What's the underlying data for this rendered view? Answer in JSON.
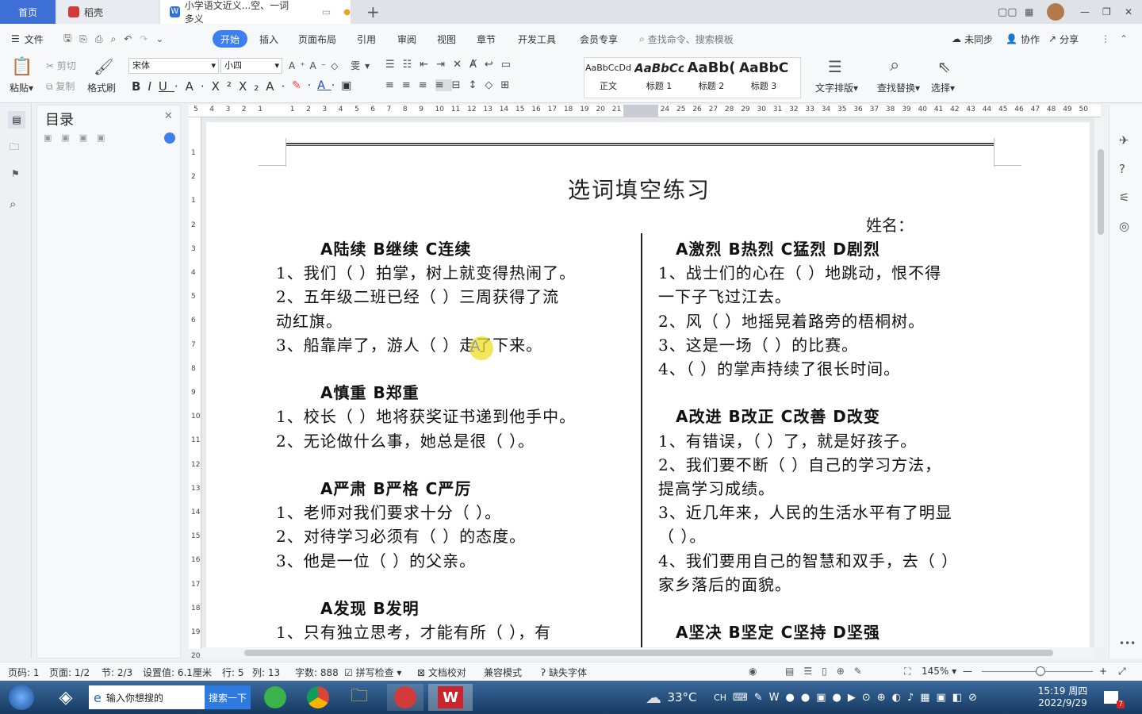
{
  "tabs": {
    "home": "首页",
    "daoke": "稻壳",
    "doc": "小学语文近义...空、一词多义"
  },
  "menu": {
    "file": "文件",
    "start": "开始",
    "insert": "插入",
    "layout": "页面布局",
    "ref": "引用",
    "review": "审阅",
    "view": "视图",
    "chapter": "章节",
    "dev": "开发工具",
    "member": "会员专享",
    "search": "查找命令、搜索模板",
    "sync": "未同步",
    "collab": "协作",
    "share": "分享"
  },
  "ribbon": {
    "paste": "粘贴",
    "cut": "剪切",
    "copy": "复制",
    "format_painter": "格式刷",
    "font": "宋体",
    "size": "小四",
    "styles": [
      {
        "preview": "AaBbCcDd",
        "name": "正文"
      },
      {
        "preview": "AaBbCc",
        "name": "标题 1"
      },
      {
        "preview": "AaBb(",
        "name": "标题 2"
      },
      {
        "preview": "AaBbC",
        "name": "标题 3"
      }
    ],
    "text_layout": "文字排版",
    "find_replace": "查找替换",
    "select": "选择"
  },
  "nav": {
    "title": "目录"
  },
  "ruler": {
    "marks": [
      "5",
      "4",
      "3",
      "2",
      "1",
      "",
      "1",
      "2",
      "3",
      "4",
      "5",
      "6",
      "7",
      "8",
      "9",
      "10",
      "11",
      "12",
      "13",
      "14",
      "15",
      "16",
      "17",
      "18",
      "19",
      "20",
      "21",
      "",
      "",
      "24",
      "25",
      "26",
      "27",
      "28",
      "29",
      "30",
      "31",
      "32",
      "33",
      "34",
      "35",
      "36",
      "37",
      "38",
      "39",
      "40",
      "41",
      "42",
      "43",
      "44",
      "45",
      "46",
      "47",
      "48",
      "49",
      "50"
    ],
    "vmarks": [
      "1",
      "2",
      "1",
      "2",
      "3",
      "4",
      "5",
      "6",
      "7",
      "8",
      "9",
      "10",
      "11",
      "12",
      "13",
      "14",
      "15",
      "16",
      "17",
      "18",
      "19",
      "20"
    ]
  },
  "doc": {
    "title": "选词填空练习",
    "name_label": "姓名：",
    "cursor_text": "A",
    "left": [
      {
        "h": "A陆续  B继续  C连续"
      },
      {
        "t": "1、我们（      ）拍掌，树上就变得热闹了。"
      },
      {
        "t": "2、五年级二班已经（      ）三周获得了流"
      },
      {
        "t": "动红旗。"
      },
      {
        "t": "3、船靠岸了，游人（      ）走了下来。"
      },
      {
        "h": "A慎重   B郑重"
      },
      {
        "t": "1、校长（      ）地将获奖证书递到他手中。"
      },
      {
        "t": "2、无论做什么事，她总是很（      ）。"
      },
      {
        "h": "A严肃   B严格   C严厉"
      },
      {
        "t": "1、老师对我们要求十分（      ）。"
      },
      {
        "t": "2、对待学习必须有（      ）的态度。"
      },
      {
        "t": "3、他是一位（     ）的父亲。"
      },
      {
        "h": "A发现   B发明"
      },
      {
        "t": "1、只有独立思考，才能有所（      ），有"
      }
    ],
    "right": [
      {
        "h": "A激烈  B热烈  C猛烈  D剧烈"
      },
      {
        "t": "1、战士们的心在（     ）地跳动，恨不得"
      },
      {
        "t": "一下子飞过江去。"
      },
      {
        "t": "2、风（     ）地摇晃着路旁的梧桐树。"
      },
      {
        "t": "3、这是一场（      ）的比赛。"
      },
      {
        "t": "4、（     ）的掌声持续了很长时间。"
      },
      {
        "h": "A改进   B改正   C改善  D改变"
      },
      {
        "t": "1、有错误，（     ）了，就是好孩子。"
      },
      {
        "t": "2、我们要不断（     ）自己的学习方法，"
      },
      {
        "t": "提高学习成绩。"
      },
      {
        "t": "3、近几年来，人民的生活水平有了明显"
      },
      {
        "t": "（     ）。"
      },
      {
        "t": "4、我们要用自己的智慧和双手，去（     ）"
      },
      {
        "t": "家乡落后的面貌。"
      },
      {
        "h": "A坚决  B坚定  C坚持  D坚强"
      }
    ]
  },
  "status": {
    "page_code": "页码: 1",
    "pages": "页面: 1/2",
    "section": "节: 2/3",
    "setting": "设置值: 6.1厘米",
    "row": "行: 5",
    "col": "列: 13",
    "words": "字数: 888",
    "spell": "拼写检查",
    "proof": "文档校对",
    "compat": "兼容模式",
    "missing_font": "缺失字体",
    "zoom": "145%"
  },
  "taskbar": {
    "search_placeholder": "输入你想搜的",
    "search_btn": "搜索一下",
    "temp": "33°C",
    "time": "15:19 周四",
    "date": "2022/9/29",
    "ime": "CH",
    "badge": "7"
  },
  "colors": {
    "accent": "#3d7ef0",
    "home_tab": "#3d6fd6",
    "daoke": "#d23a3a",
    "wps_red": "#c8262c"
  }
}
